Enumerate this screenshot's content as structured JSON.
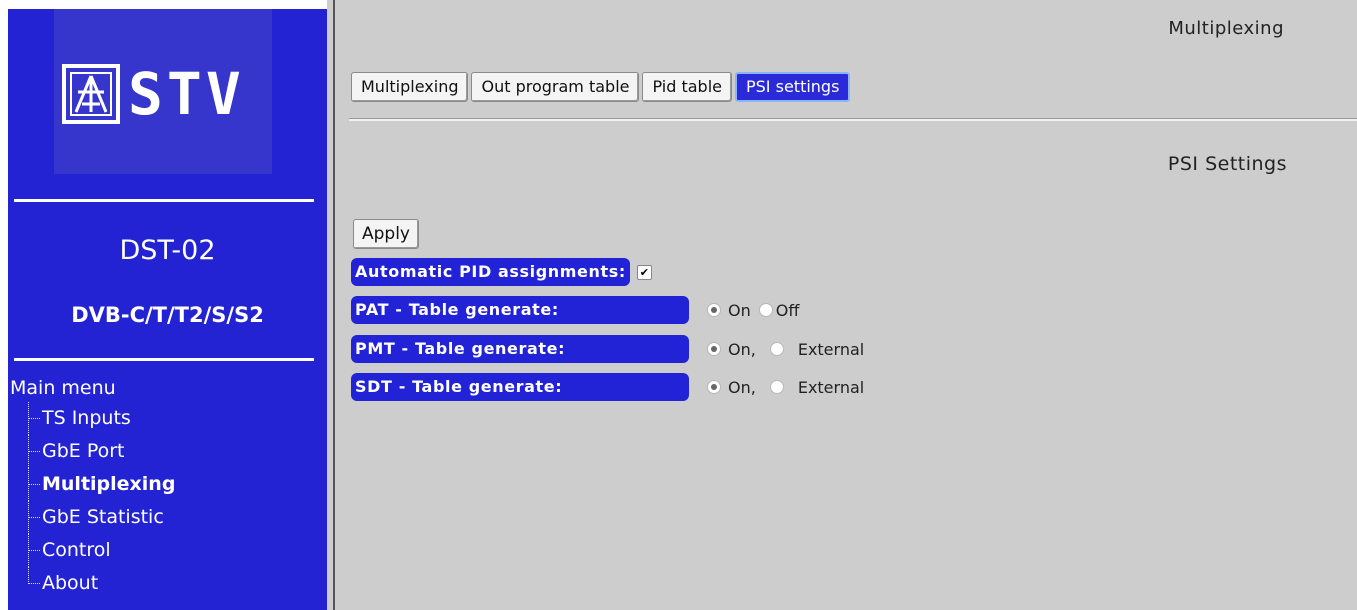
{
  "sidebar": {
    "logo_icon": "stv-logo-icon",
    "logo_text": "STV",
    "model_name": "DST-02",
    "model_standard": "DVB-C/T/T2/S/S2",
    "menu_title": "Main menu",
    "menu_items": [
      {
        "label": "TS Inputs",
        "active": false
      },
      {
        "label": "GbE Port",
        "active": false
      },
      {
        "label": "Multiplexing",
        "active": true
      },
      {
        "label": "GbE Statistic",
        "active": false
      },
      {
        "label": "Control",
        "active": false
      },
      {
        "label": "About",
        "active": false
      }
    ],
    "colors": {
      "background": "#2323d4",
      "logo_bg": "#3636cc"
    }
  },
  "main": {
    "page_title": "Multiplexing",
    "tabs": [
      {
        "label": "Multiplexing",
        "active": false
      },
      {
        "label": "Out program table",
        "active": false
      },
      {
        "label": "Pid table",
        "active": false
      },
      {
        "label": "PSI settings",
        "active": true
      }
    ],
    "section_title": "PSI Settings",
    "apply_label": "Apply",
    "settings": {
      "auto_pid": {
        "label": "Automatic PID assignments:",
        "checked": true
      },
      "pat": {
        "label": "PAT - Table generate:",
        "option1": "On",
        "option2": "Off",
        "selected": "On"
      },
      "pmt": {
        "label": "PMT - Table generate:",
        "option1": "On,",
        "option2": "External",
        "selected": "On,"
      },
      "sdt": {
        "label": "SDT - Table generate:",
        "option1": "On,",
        "option2": "External",
        "selected": "On,"
      }
    },
    "colors": {
      "label_bg": "#2222d6",
      "active_tab": "#2a2ad8",
      "page_bg": "#cdcdcd"
    }
  }
}
